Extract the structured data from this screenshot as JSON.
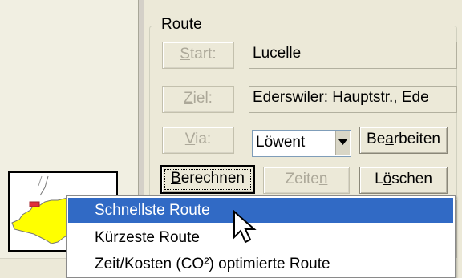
{
  "route_group": {
    "legend": "Route",
    "start": {
      "label_pre": "",
      "label_accel": "S",
      "label_post": "tart:",
      "value": "Lucelle"
    },
    "ziel": {
      "label_pre": "",
      "label_accel": "Z",
      "label_post": "iel:",
      "value": "Ederswiler: Hauptstr., Ede"
    },
    "via": {
      "label_pre": "",
      "label_accel": "V",
      "label_post": "ia:",
      "value": "Löwent"
    },
    "edit_button": {
      "pre": "Be",
      "accel": "a",
      "post": "rbeiten"
    },
    "calc_button": {
      "pre": "",
      "accel": "B",
      "post": "erechnen"
    },
    "times_button": {
      "pre": "Zeite",
      "accel": "n",
      "post": ""
    },
    "delete_button": {
      "pre": "L",
      "accel": "ö",
      "post": "schen"
    }
  },
  "context_menu": {
    "items": [
      {
        "label": "Schnellste Route",
        "highlighted": true
      },
      {
        "label": "Kürzeste Route",
        "highlighted": false
      },
      {
        "label": "Zeit/Kosten (CO²) optimierte Route",
        "highlighted": false
      }
    ]
  },
  "colors": {
    "highlight": "#316ac5",
    "map_fill": "#ffff00",
    "map_marker": "#e0303a"
  },
  "icons": {
    "cursor": "mouse-pointer-icon",
    "dropdown": "chevron-down-icon"
  }
}
